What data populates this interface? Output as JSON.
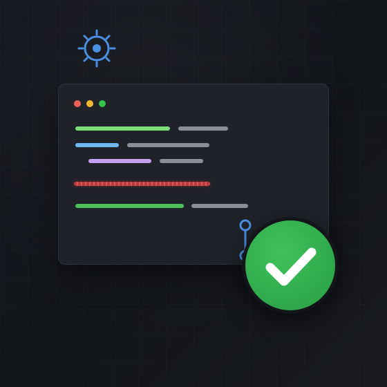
{
  "colors": {
    "background": "#13161c",
    "editor_bg": "#1f2228",
    "accent_blue": "#4a90e2",
    "success_green": "#2ea84a",
    "error_red": "#d24a4a"
  },
  "window_dots": [
    "#ec5f55",
    "#f4b82f",
    "#34c24a"
  ],
  "code_lines": [
    {
      "colors": [
        "#7ede7a",
        "#8b8e94"
      ]
    },
    {
      "colors": [
        "#6fb7f0",
        "#8b8e94"
      ]
    },
    {
      "colors": [
        "#c5a0f0",
        "#8b8e94"
      ]
    },
    {
      "colors": [
        "#4fbf5a",
        "#8b8e94"
      ]
    }
  ],
  "icons": {
    "gear": "gear-icon",
    "check": "checkmark-icon",
    "connector": "connector-icon",
    "error": "error-underline"
  }
}
